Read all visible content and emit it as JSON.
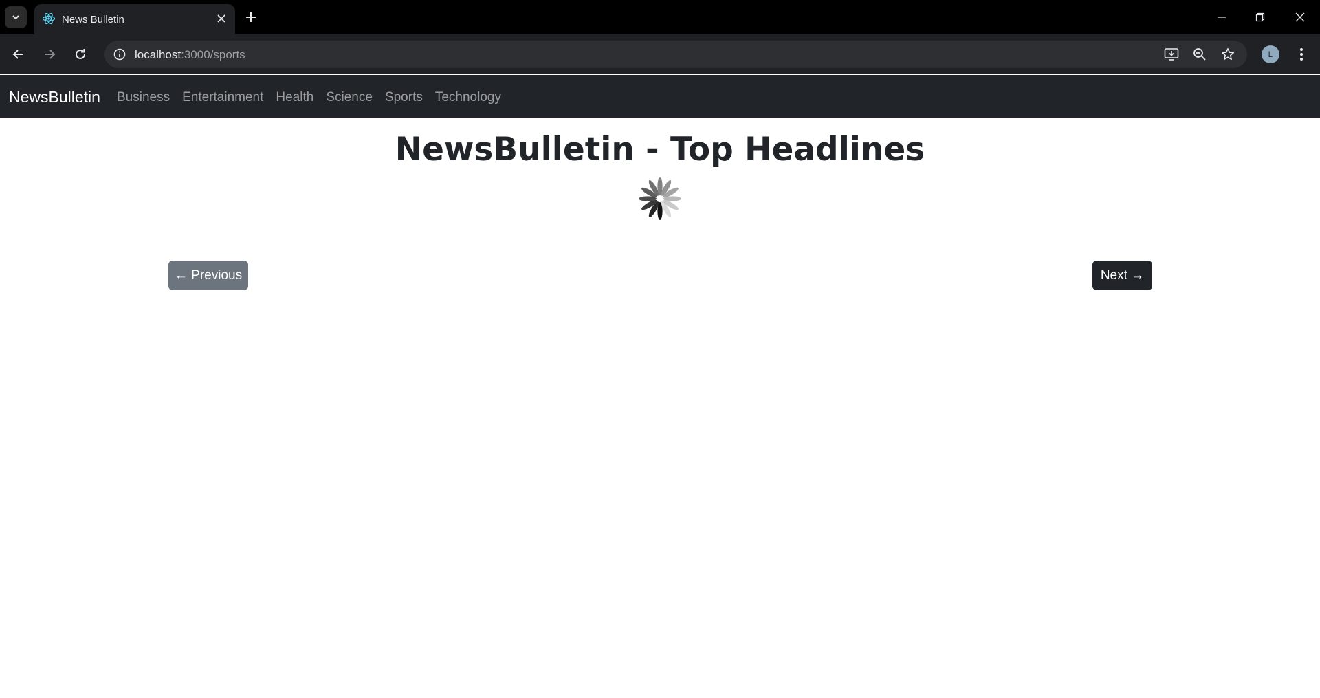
{
  "browser": {
    "tab_title": "News Bulletin",
    "url_host": "localhost",
    "url_path": ":3000/sports",
    "profile_initial": "L"
  },
  "navbar": {
    "brand": "NewsBulletin",
    "links": [
      "Business",
      "Entertainment",
      "Health",
      "Science",
      "Sports",
      "Technology"
    ]
  },
  "main": {
    "headline": "NewsBulletin - Top Headlines",
    "prev_label": "← Previous",
    "next_label": "Next →"
  },
  "colors": {
    "navbar_bg": "#212529",
    "prev_bg": "#6c757d",
    "next_bg": "#212529"
  }
}
